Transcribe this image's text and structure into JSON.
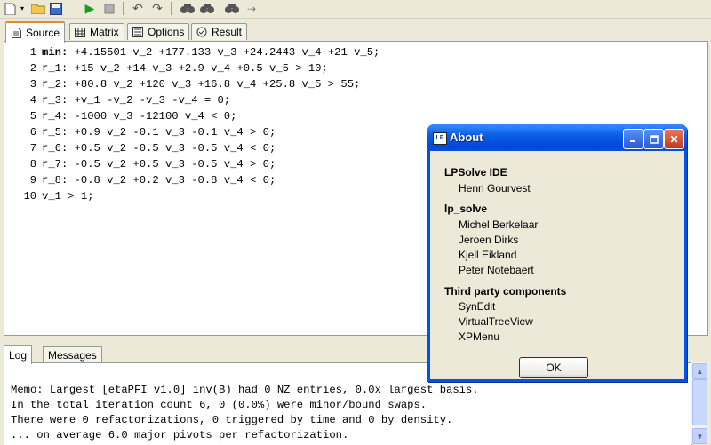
{
  "toolbar": {
    "icons": [
      "new-file-icon",
      "open-folder-icon",
      "save-icon",
      "run-icon",
      "stop-icon",
      "undo-icon",
      "redo-icon",
      "find-icon",
      "find-next-icon",
      "replace-icon",
      "goto-icon"
    ]
  },
  "tabs": [
    {
      "label": "Source",
      "icon": "source-icon"
    },
    {
      "label": "Matrix",
      "icon": "matrix-icon"
    },
    {
      "label": "Options",
      "icon": "options-icon"
    },
    {
      "label": "Result",
      "icon": "result-icon"
    }
  ],
  "editor": {
    "line_numbers": [
      "1",
      "2",
      "3",
      "4",
      "5",
      "6",
      "7",
      "8",
      "9",
      "10"
    ],
    "lines": [
      {
        "head": "min:",
        "rest": " +4.15501 v_2 +177.133 v_3 +24.2443 v_4 +21 v_5;"
      },
      {
        "head": "",
        "rest": "r_1: +15 v_2 +14 v_3 +2.9 v_4 +0.5 v_5 > 10;"
      },
      {
        "head": "",
        "rest": "r_2: +80.8 v_2 +120 v_3 +16.8 v_4 +25.8 v_5 > 55;"
      },
      {
        "head": "",
        "rest": "r_3: +v_1 -v_2 -v_3 -v_4 = 0;"
      },
      {
        "head": "",
        "rest": "r_4: -1000 v_3 -12100 v_4 < 0;"
      },
      {
        "head": "",
        "rest": "r_5: +0.9 v_2 -0.1 v_3 -0.1 v_4 > 0;"
      },
      {
        "head": "",
        "rest": "r_6: +0.5 v_2 -0.5 v_3 -0.5 v_4 < 0;"
      },
      {
        "head": "",
        "rest": "r_7: -0.5 v_2 +0.5 v_3 -0.5 v_4 > 0;"
      },
      {
        "head": "",
        "rest": "r_8: -0.8 v_2 +0.2 v_3 -0.8 v_4 < 0;"
      },
      {
        "head": "",
        "rest": "v_1 > 1;"
      }
    ]
  },
  "bottom_tabs": [
    {
      "label": "Log"
    },
    {
      "label": "Messages"
    }
  ],
  "log": {
    "lines": [
      "Memo: Largest [etaPFI v1.0] inv(B) had 0 NZ entries, 0.0x largest basis.",
      "In the total iteration count 6, 0 (0.0%) were minor/bound swaps.",
      "There were 0 refactorizations, 0 triggered by time and 0 by density.",
      "... on average 6.0 major pivots per refactorization."
    ]
  },
  "about_dialog": {
    "title": "About",
    "sections": [
      {
        "heading": "LPSolve IDE",
        "items": [
          "Henri Gourvest"
        ]
      },
      {
        "heading": "lp_solve",
        "items": [
          "Michel Berkelaar",
          "Jeroen Dirks",
          "Kjell Eikland",
          "Peter Notebaert"
        ]
      },
      {
        "heading": "Third party components",
        "items": [
          "SynEdit",
          "VirtualTreeView",
          "XPMenu"
        ]
      }
    ],
    "ok_label": "OK"
  }
}
